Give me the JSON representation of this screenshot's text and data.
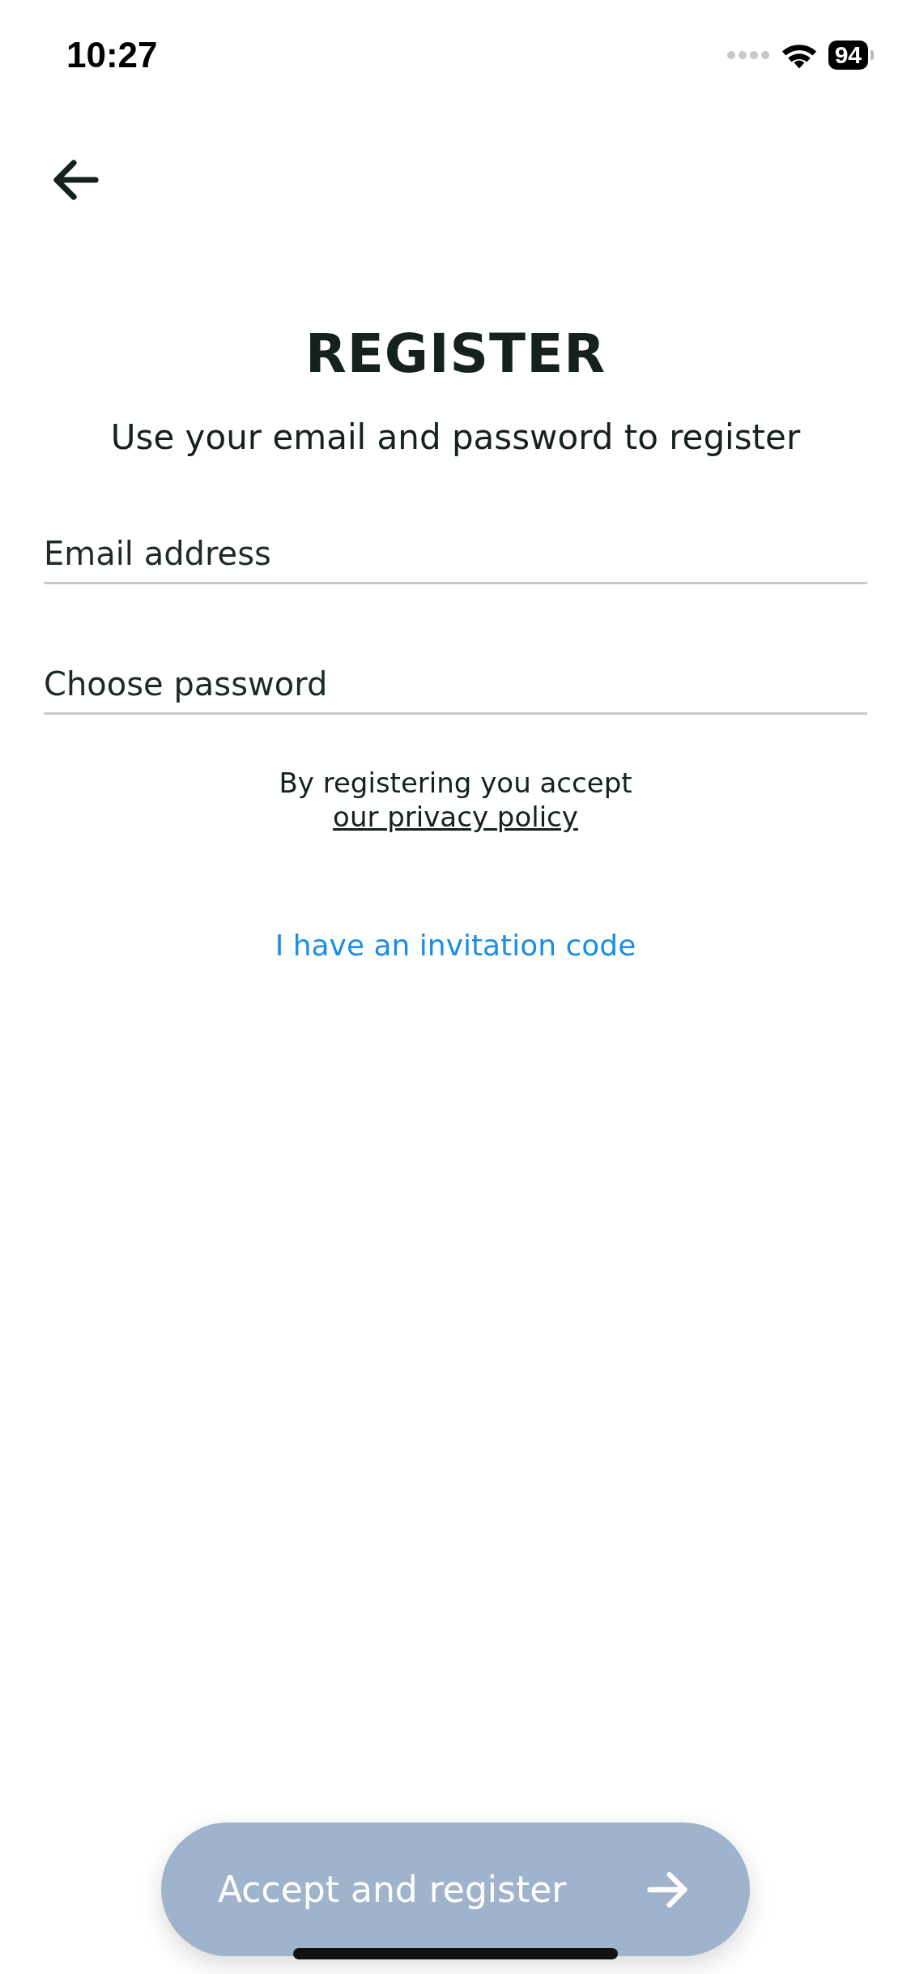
{
  "status_bar": {
    "time": "10:27",
    "battery": "94"
  },
  "title": "REGISTER",
  "subtitle": "Use your email and password to register",
  "fields": [
    {
      "placeholder": "Email address"
    },
    {
      "placeholder": "Choose password"
    }
  ],
  "consent": {
    "text": "By registering you accept",
    "link": "our privacy policy"
  },
  "invitation_link": "I have an invitation code",
  "submit_button": {
    "label": "Accept and register",
    "disabled": true
  }
}
